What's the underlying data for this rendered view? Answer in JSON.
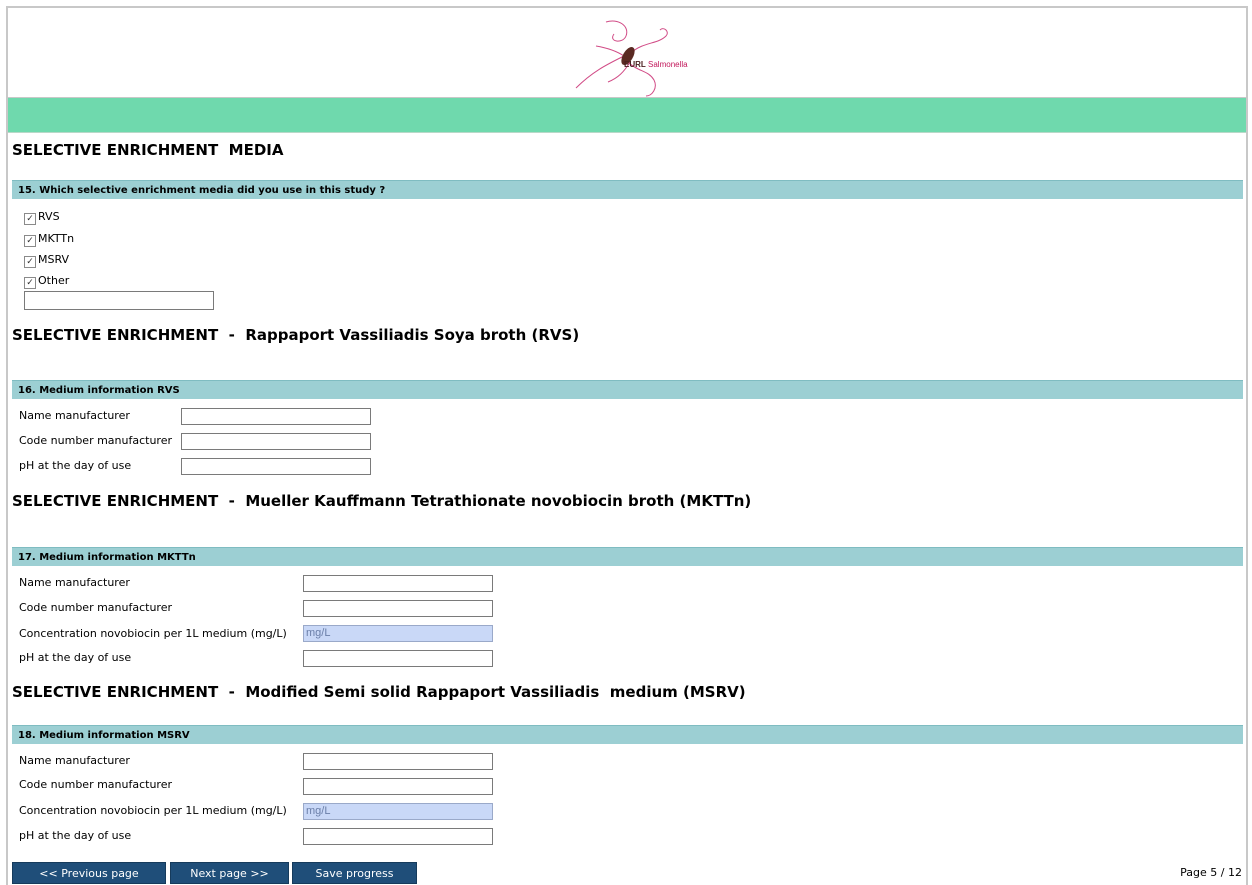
{
  "logo": {
    "brand_bold": "EURL",
    "brand_rest": "Salmonella"
  },
  "section_media_title": "SELECTIVE ENRICHMENT  MEDIA",
  "q15": {
    "title": "15. Which selective enrichment media did you use in this study ?",
    "options": [
      {
        "label": "RVS",
        "checked": true
      },
      {
        "label": "MKTTn",
        "checked": true
      },
      {
        "label": "MSRV",
        "checked": true
      },
      {
        "label": "Other",
        "checked": true
      }
    ],
    "other_value": ""
  },
  "section_rvs_title": "SELECTIVE ENRICHMENT  -  Rappaport Vassiliadis Soya broth (RVS)",
  "q16": {
    "title": "16. Medium information RVS",
    "fields": [
      {
        "label": "Name manufacturer",
        "value": ""
      },
      {
        "label": "Code number manufacturer",
        "value": ""
      },
      {
        "label": "pH at the day of use",
        "value": ""
      }
    ]
  },
  "section_mkttn_title": "SELECTIVE ENRICHMENT  -  Mueller Kauffmann Tetrathionate novobiocin broth (MKTTn)",
  "q17": {
    "title": "17. Medium information MKTTn",
    "fields": [
      {
        "label": "Name manufacturer",
        "value": ""
      },
      {
        "label": "Code number manufacturer",
        "value": ""
      },
      {
        "label": "Concentration novobiocin per 1L medium (mg/L)",
        "value": "",
        "placeholder": "mg/L"
      },
      {
        "label": "pH at the day of use",
        "value": ""
      }
    ]
  },
  "section_msrv_title": "SELECTIVE ENRICHMENT  -  Modified Semi solid Rappaport Vassiliadis  medium (MSRV)",
  "q18": {
    "title": "18. Medium information MSRV",
    "fields": [
      {
        "label": "Name manufacturer",
        "value": ""
      },
      {
        "label": "Code number manufacturer",
        "value": ""
      },
      {
        "label": "Concentration novobiocin per 1L medium (mg/L)",
        "value": "",
        "placeholder": "mg/L"
      },
      {
        "label": "pH at the day of use",
        "value": ""
      }
    ]
  },
  "nav": {
    "previous_label": "<< Previous page",
    "next_label": "Next page >>",
    "save_label": "Save progress",
    "page_indicator": "Page 5 / 12"
  },
  "colors": {
    "header_band": "#6fd9ad",
    "question_bar": "#9ccfd3",
    "button": "#1f4e79",
    "highlight_field": "#c9d8f7"
  }
}
